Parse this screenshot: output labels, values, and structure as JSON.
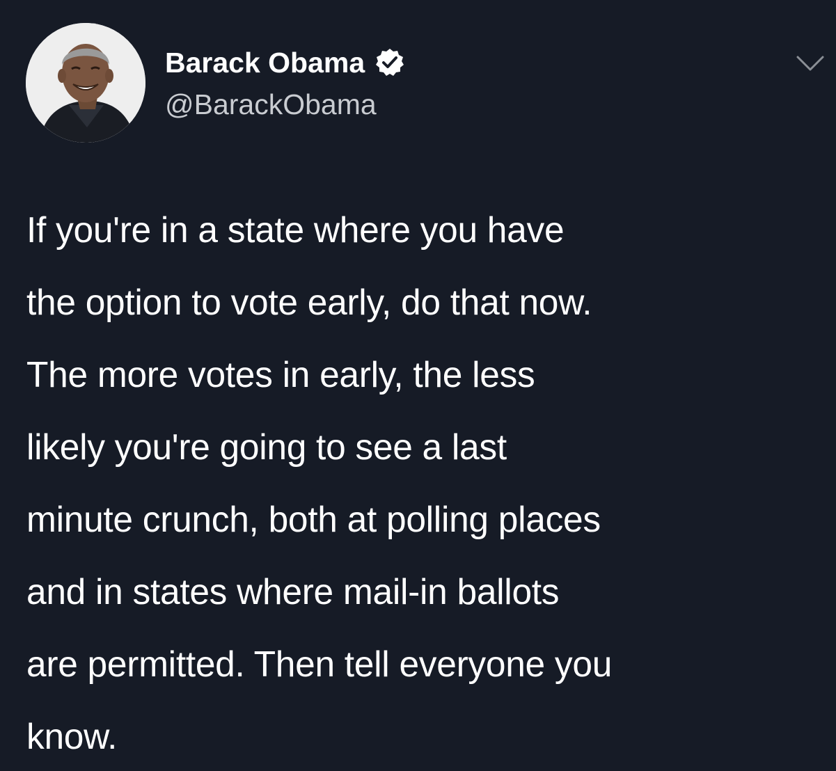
{
  "tweet": {
    "author": {
      "display_name": "Barack Obama",
      "handle": "@BarackObama",
      "verified": true,
      "avatar_icon": "profile-photo",
      "verified_icon": "verified-badge-icon"
    },
    "menu_icon": "chevron-down-icon",
    "text_lines": [
      "If you're in a state where you have",
      "the option to vote early, do that now.",
      "The more votes in early, the less",
      "likely you're going to see a last",
      "minute crunch, both at polling places",
      "and in states where mail-in ballots",
      "are permitted. Then tell everyone you",
      "know."
    ]
  },
  "colors": {
    "background": "#161b26",
    "text": "#ffffff",
    "handle": "#c9ccd1",
    "chevron": "#8b8f96"
  }
}
